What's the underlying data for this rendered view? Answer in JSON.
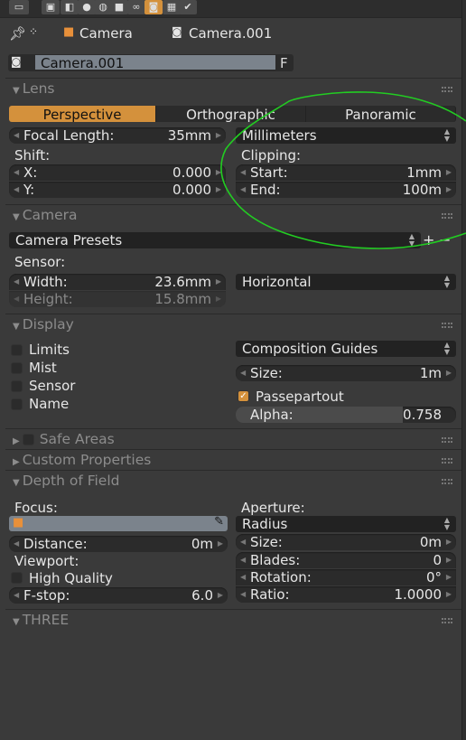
{
  "header": {
    "context_tabs": [
      "render-layers",
      "scene",
      "world",
      "object",
      "constraints",
      "camera-data",
      "texture",
      "modifiers"
    ],
    "active_tab": "camera-data"
  },
  "breadcrumb": {
    "object": "Camera",
    "data": "Camera.001"
  },
  "datablock": {
    "name": "Camera.001",
    "fake_user": "F"
  },
  "lens": {
    "title": "Lens",
    "types": [
      "Perspective",
      "Orthographic",
      "Panoramic"
    ],
    "active_type": "Perspective",
    "focal_label": "Focal Length:",
    "focal_value": "35mm",
    "unit": "Millimeters",
    "shift_label": "Shift:",
    "x_label": "X:",
    "x_value": "0.000",
    "y_label": "Y:",
    "y_value": "0.000",
    "clip_label": "Clipping:",
    "start_label": "Start:",
    "start_value": "1mm",
    "end_label": "End:",
    "end_value": "100m"
  },
  "camera": {
    "title": "Camera",
    "presets": "Camera Presets",
    "add": "+",
    "remove": "−",
    "sensor_label": "Sensor:",
    "width_label": "Width:",
    "width_value": "23.6mm",
    "height_label": "Height:",
    "height_value": "15.8mm",
    "fit": "Horizontal"
  },
  "display": {
    "title": "Display",
    "checks": [
      {
        "label": "Limits",
        "checked": false
      },
      {
        "label": "Mist",
        "checked": false
      },
      {
        "label": "Sensor",
        "checked": false
      },
      {
        "label": "Name",
        "checked": false
      }
    ],
    "guides": "Composition Guides",
    "size_label": "Size:",
    "size_value": "1m",
    "passepartout": "Passepartout",
    "passepartout_checked": true,
    "alpha_label": "Alpha:",
    "alpha_value": "0.758",
    "alpha_fraction": 0.758
  },
  "safe_areas": {
    "title": "Safe Areas"
  },
  "custom_props": {
    "title": "Custom Properties"
  },
  "dof": {
    "title": "Depth of Field",
    "focus_label": "Focus:",
    "distance_label": "Distance:",
    "distance_value": "0m",
    "viewport_label": "Viewport:",
    "hq_label": "High Quality",
    "fstop_label": "F-stop:",
    "fstop_value": "6.0",
    "aperture_label": "Aperture:",
    "aperture_type": "Radius",
    "size_label": "Size:",
    "size_value": "0m",
    "blades_label": "Blades:",
    "blades_value": "0",
    "rotation_label": "Rotation:",
    "rotation_value": "0°",
    "ratio_label": "Ratio:",
    "ratio_value": "1.0000"
  },
  "three": {
    "title": "THREE"
  },
  "colors": {
    "accent": "#d4913c",
    "annotation": "#22cc22"
  }
}
